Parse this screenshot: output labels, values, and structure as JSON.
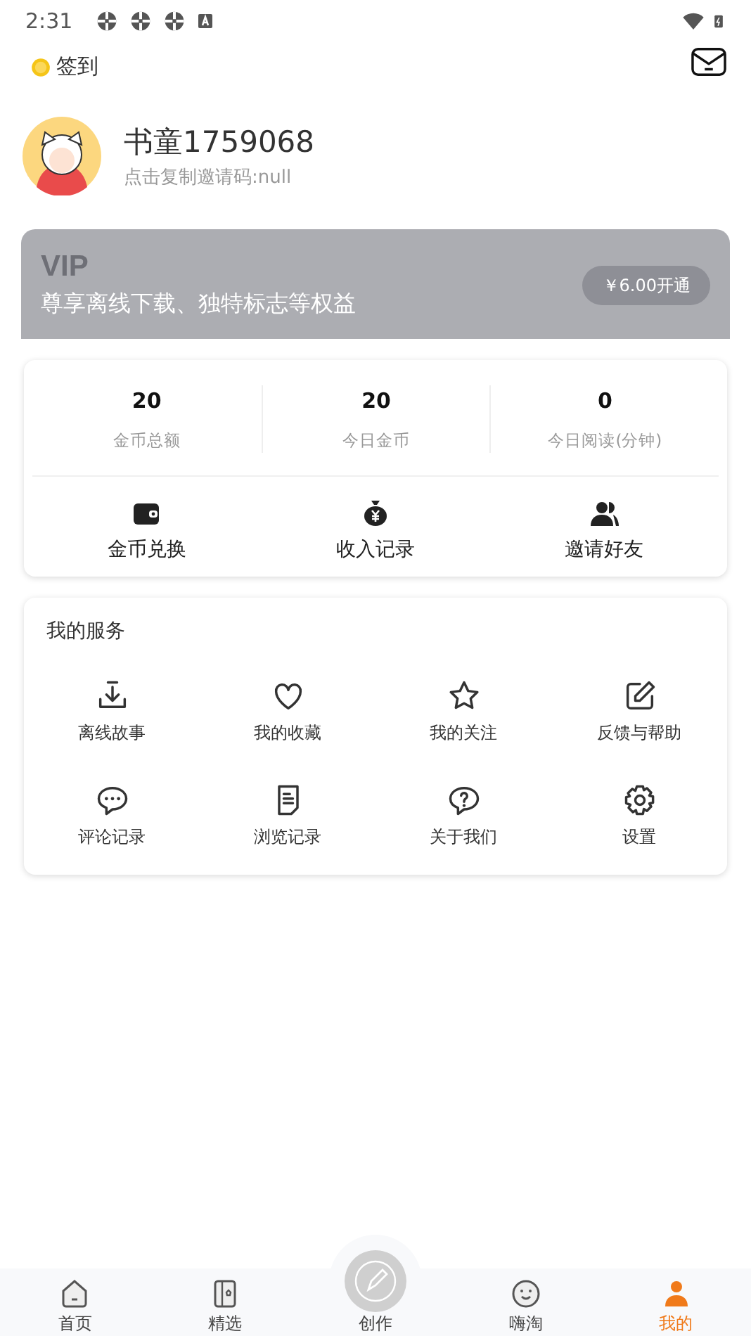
{
  "status_bar": {
    "time": "2:31"
  },
  "header": {
    "checkin": "签到"
  },
  "profile": {
    "name": "书童1759068",
    "invite": "点击复制邀请码:null"
  },
  "vip": {
    "title": "VIP",
    "subtitle": "尊享离线下载、独特标志等权益",
    "button": "￥6.00开通"
  },
  "stats": [
    {
      "value": "20",
      "label": "金币总额"
    },
    {
      "value": "20",
      "label": "今日金币"
    },
    {
      "value": "0",
      "label": "今日阅读(分钟)"
    }
  ],
  "actions": [
    {
      "kind": "wallet",
      "label": "金币兑换"
    },
    {
      "kind": "moneybag",
      "label": "收入记录"
    },
    {
      "kind": "people",
      "label": "邀请好友"
    }
  ],
  "services": {
    "title": "我的服务",
    "items": [
      {
        "kind": "download",
        "label": "离线故事"
      },
      {
        "kind": "heart",
        "label": "我的收藏"
      },
      {
        "kind": "star",
        "label": "我的关注"
      },
      {
        "kind": "edit",
        "label": "反馈与帮助"
      },
      {
        "kind": "chat",
        "label": "评论记录"
      },
      {
        "kind": "doc",
        "label": "浏览记录"
      },
      {
        "kind": "question",
        "label": "关于我们"
      },
      {
        "kind": "gear",
        "label": "设置"
      }
    ]
  },
  "bottom_nav": [
    {
      "kind": "home",
      "label": "首页",
      "selected": false
    },
    {
      "kind": "book",
      "label": "精选",
      "selected": false
    },
    {
      "kind": "create",
      "label": "创作",
      "selected": false
    },
    {
      "kind": "face",
      "label": "嗨淘",
      "selected": false
    },
    {
      "kind": "me",
      "label": "我的",
      "selected": true
    }
  ]
}
